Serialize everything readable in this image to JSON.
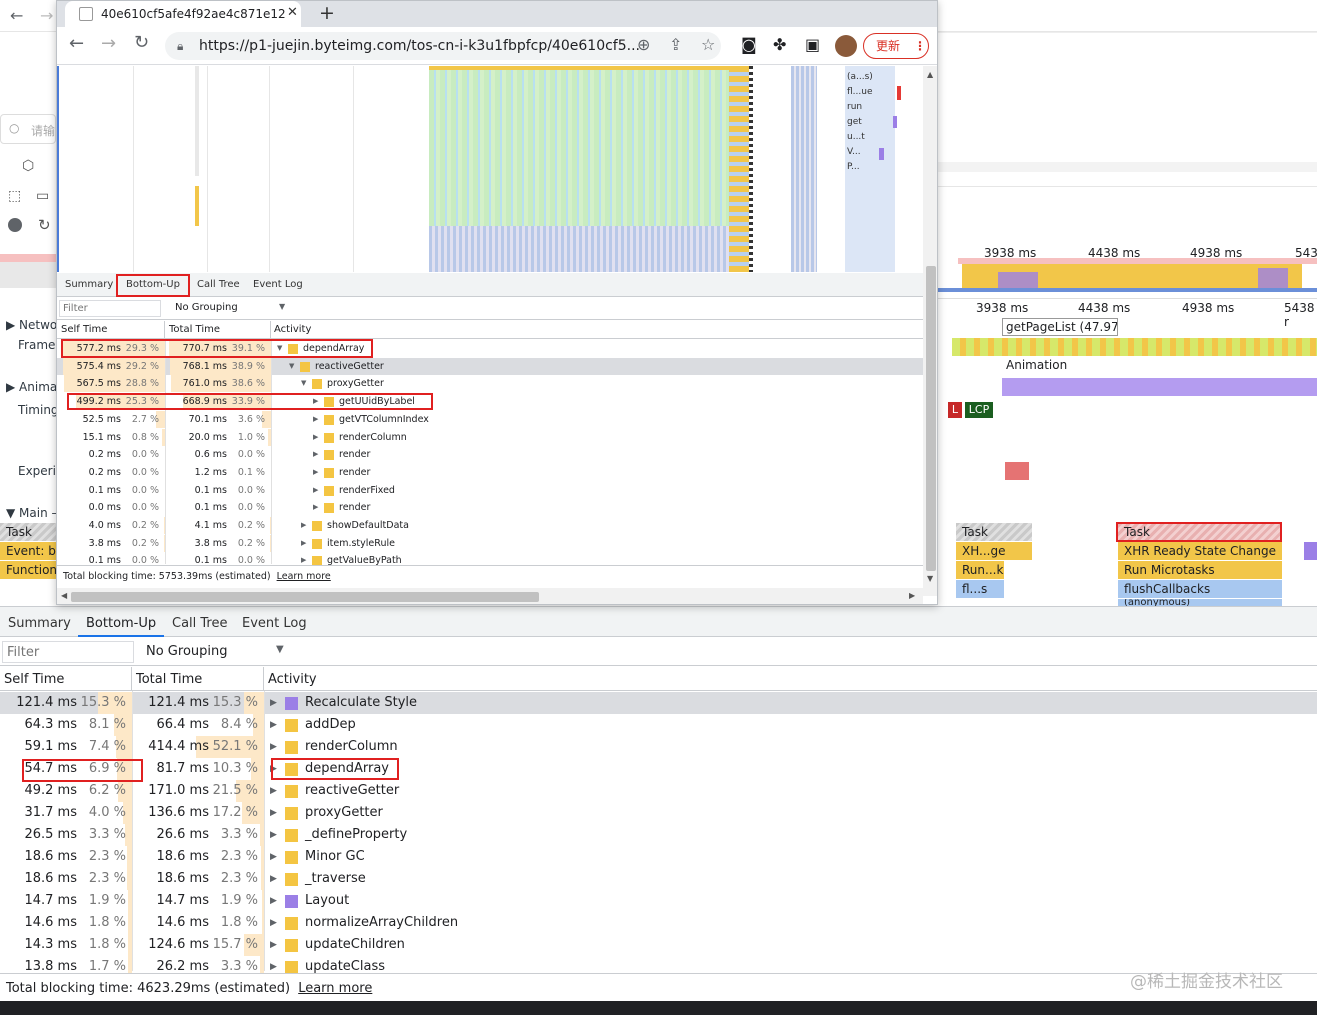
{
  "popup": {
    "tab_title": "40e610cf5afe4f92ae4c871e12",
    "url": "https://p1-juejin.byteimg.com/tos-cn-i-k3u1fbpfcp/40e610cf5...",
    "update_button": "更新",
    "flame_labels": [
      "(a...s)",
      "fl...ue",
      "run",
      "get",
      "u...t",
      "V...",
      "P..."
    ],
    "tabs": [
      "Summary",
      "Bottom-Up",
      "Call Tree",
      "Event Log"
    ],
    "filter_placeholder": "Filter",
    "grouping": "No Grouping",
    "columns": [
      "Self Time",
      "Total Time",
      "Activity"
    ],
    "rows": [
      {
        "self_ms": "577.2 ms",
        "self_pct": "29.3 %",
        "total_ms": "770.7 ms",
        "total_pct": "39.1 %",
        "activity": "dependArray",
        "indent": 0,
        "expanded": true
      },
      {
        "self_ms": "575.4 ms",
        "self_pct": "29.2 %",
        "total_ms": "768.1 ms",
        "total_pct": "38.9 %",
        "activity": "reactiveGetter",
        "indent": 1,
        "expanded": true,
        "selected": true
      },
      {
        "self_ms": "567.5 ms",
        "self_pct": "28.8 %",
        "total_ms": "761.0 ms",
        "total_pct": "38.6 %",
        "activity": "proxyGetter",
        "indent": 2,
        "expanded": true
      },
      {
        "self_ms": "499.2 ms",
        "self_pct": "25.3 %",
        "total_ms": "668.9 ms",
        "total_pct": "33.9 %",
        "activity": "getUUidByLabel",
        "indent": 3
      },
      {
        "self_ms": "52.5 ms",
        "self_pct": "2.7 %",
        "total_ms": "70.1 ms",
        "total_pct": "3.6 %",
        "activity": "getVTColumnIndex",
        "indent": 3
      },
      {
        "self_ms": "15.1 ms",
        "self_pct": "0.8 %",
        "total_ms": "20.0 ms",
        "total_pct": "1.0 %",
        "activity": "renderColumn",
        "indent": 3
      },
      {
        "self_ms": "0.2 ms",
        "self_pct": "0.0 %",
        "total_ms": "0.6 ms",
        "total_pct": "0.0 %",
        "activity": "render",
        "indent": 3
      },
      {
        "self_ms": "0.2 ms",
        "self_pct": "0.0 %",
        "total_ms": "1.2 ms",
        "total_pct": "0.1 %",
        "activity": "render",
        "indent": 3
      },
      {
        "self_ms": "0.1 ms",
        "self_pct": "0.0 %",
        "total_ms": "0.1 ms",
        "total_pct": "0.0 %",
        "activity": "renderFixed",
        "indent": 3
      },
      {
        "self_ms": "0.0 ms",
        "self_pct": "0.0 %",
        "total_ms": "0.1 ms",
        "total_pct": "0.0 %",
        "activity": "render",
        "indent": 3
      },
      {
        "self_ms": "4.0 ms",
        "self_pct": "0.2 %",
        "total_ms": "4.1 ms",
        "total_pct": "0.2 %",
        "activity": "showDefaultData",
        "indent": 2
      },
      {
        "self_ms": "3.8 ms",
        "self_pct": "0.2 %",
        "total_ms": "3.8 ms",
        "total_pct": "0.2 %",
        "activity": "item.styleRule",
        "indent": 2
      },
      {
        "self_ms": "0.1 ms",
        "self_pct": "0.0 %",
        "total_ms": "0.1 ms",
        "total_pct": "0.0 %",
        "activity": "getValueByPath",
        "indent": 2
      }
    ],
    "footer": "Total blocking time: 5753.39ms (estimated)",
    "learn_more": "Learn more"
  },
  "background": {
    "search_placeholder": "请输",
    "left_labels": [
      "Network",
      "Frames",
      "Animat",
      "Timing",
      "Experie",
      "Main —"
    ],
    "ruler_top": [
      "3938 ms",
      "4438 ms",
      "4938 ms",
      "543"
    ],
    "ruler_bottom": [
      "3938 ms",
      "4438 ms",
      "4938 ms",
      "5438 r"
    ],
    "frame_tooltip": "getPageList (47.97...",
    "animation_label": "Animation",
    "lcp_badge": "LCP",
    "l_badge": "L",
    "left_track_labels": [
      "Task",
      "Event: be",
      "Function"
    ],
    "main_blocks": [
      "Task",
      "XH...ge",
      "Run...ks",
      "fl...s",
      "Task",
      "XHR Ready State Change",
      "Run Microtasks",
      "flushCallbacks",
      "(anonymous)"
    ]
  },
  "bottom": {
    "tabs": [
      "Summary",
      "Bottom-Up",
      "Call Tree",
      "Event Log"
    ],
    "filter_placeholder": "Filter",
    "grouping": "No Grouping",
    "columns": [
      "Self Time",
      "Total Time",
      "Activity"
    ],
    "rows": [
      {
        "self_ms": "121.4 ms",
        "self_pct": "15.3 %",
        "total_ms": "121.4 ms",
        "total_pct": "15.3 %",
        "activity": "Recalculate Style",
        "color": "#9b7fe6",
        "selected": true
      },
      {
        "self_ms": "64.3 ms",
        "self_pct": "8.1 %",
        "total_ms": "66.4 ms",
        "total_pct": "8.4 %",
        "activity": "addDep",
        "color": "#f4c542"
      },
      {
        "self_ms": "59.1 ms",
        "self_pct": "7.4 %",
        "total_ms": "414.4 ms",
        "total_pct": "52.1 %",
        "activity": "renderColumn",
        "color": "#f4c542"
      },
      {
        "self_ms": "54.7 ms",
        "self_pct": "6.9 %",
        "total_ms": "81.7 ms",
        "total_pct": "10.3 %",
        "activity": "dependArray",
        "color": "#f4c542"
      },
      {
        "self_ms": "49.2 ms",
        "self_pct": "6.2 %",
        "total_ms": "171.0 ms",
        "total_pct": "21.5 %",
        "activity": "reactiveGetter",
        "color": "#f4c542"
      },
      {
        "self_ms": "31.7 ms",
        "self_pct": "4.0 %",
        "total_ms": "136.6 ms",
        "total_pct": "17.2 %",
        "activity": "proxyGetter",
        "color": "#f4c542"
      },
      {
        "self_ms": "26.5 ms",
        "self_pct": "3.3 %",
        "total_ms": "26.6 ms",
        "total_pct": "3.3 %",
        "activity": "_defineProperty",
        "color": "#f4c542"
      },
      {
        "self_ms": "18.6 ms",
        "self_pct": "2.3 %",
        "total_ms": "18.6 ms",
        "total_pct": "2.3 %",
        "activity": "Minor GC",
        "color": "#f4c542"
      },
      {
        "self_ms": "18.6 ms",
        "self_pct": "2.3 %",
        "total_ms": "18.6 ms",
        "total_pct": "2.3 %",
        "activity": "_traverse",
        "color": "#f4c542"
      },
      {
        "self_ms": "14.7 ms",
        "self_pct": "1.9 %",
        "total_ms": "14.7 ms",
        "total_pct": "1.9 %",
        "activity": "Layout",
        "color": "#9b7fe6"
      },
      {
        "self_ms": "14.6 ms",
        "self_pct": "1.8 %",
        "total_ms": "14.6 ms",
        "total_pct": "1.8 %",
        "activity": "normalizeArrayChildren",
        "color": "#f4c542"
      },
      {
        "self_ms": "14.3 ms",
        "self_pct": "1.8 %",
        "total_ms": "124.6 ms",
        "total_pct": "15.7 %",
        "activity": "updateChildren",
        "color": "#f4c542"
      },
      {
        "self_ms": "13.8 ms",
        "self_pct": "1.7 %",
        "total_ms": "26.2 ms",
        "total_pct": "3.3 %",
        "activity": "updateClass",
        "color": "#f4c542"
      }
    ],
    "footer": "Total blocking time: 4623.29ms (estimated)",
    "learn_more": "Learn more"
  },
  "watermark": "@稀土掘金技术社区"
}
